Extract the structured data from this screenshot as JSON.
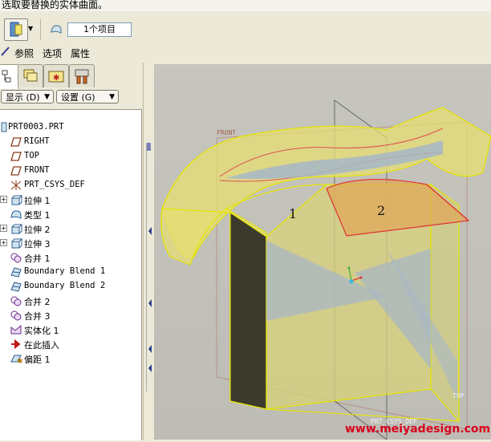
{
  "prompt": {
    "text": "选取要替换的实体曲面。"
  },
  "dashboard": {
    "selection_count": "1个项目"
  },
  "tabs": [
    {
      "label": "参照"
    },
    {
      "label": "选项"
    },
    {
      "label": "属性"
    }
  ],
  "model_tree": {
    "show_button": "显示 (D)",
    "settings_button": "设置 (G)",
    "items": [
      {
        "label": "PRT0003.PRT",
        "icon": "part-icon"
      },
      {
        "label": "RIGHT",
        "icon": "datum-plane-icon"
      },
      {
        "label": "TOP",
        "icon": "datum-plane-icon"
      },
      {
        "label": "FRONT",
        "icon": "datum-plane-icon"
      },
      {
        "label": "PRT_CSYS_DEF",
        "icon": "coordinate-system-icon"
      },
      {
        "label": "拉伸 1",
        "icon": "extrude-icon"
      },
      {
        "label": "类型 1",
        "icon": "surface-icon"
      },
      {
        "label": "拉伸 2",
        "icon": "extrude-icon"
      },
      {
        "label": "拉伸 3",
        "icon": "extrude-icon"
      },
      {
        "label": "合并 1",
        "icon": "merge-icon"
      },
      {
        "label": "Boundary Blend 1",
        "icon": "boundary-blend-icon"
      },
      {
        "label": "Boundary Blend 2",
        "icon": "boundary-blend-icon"
      },
      {
        "label": "合并 2",
        "icon": "merge-icon"
      },
      {
        "label": "合并 3",
        "icon": "merge-icon"
      },
      {
        "label": "实体化 1",
        "icon": "solidify-icon"
      },
      {
        "label": "在此插入",
        "icon": "insert-here-arrow-icon"
      },
      {
        "label": "偏距 1",
        "icon": "offset-icon"
      }
    ]
  },
  "viewport": {
    "datum_labels": {
      "front": "FRONT",
      "top": "TOP",
      "csys": "PRT_CSYS_DEF"
    },
    "annotations": [
      "1",
      "2"
    ]
  },
  "watermark": {
    "text": "www.meiyadesign.com"
  },
  "colors": {
    "model_fill": "#e8e070",
    "model_edge": "#e6e600",
    "selected_edge": "#e03030",
    "viewport_bg": "#c3c2bc",
    "watermark": "#d9001b"
  }
}
